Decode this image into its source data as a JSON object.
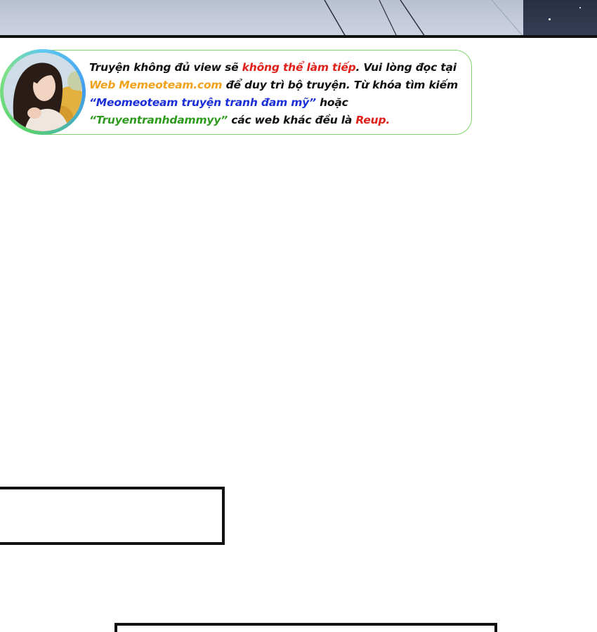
{
  "notice": {
    "line1_a": "Truyện không đủ view sẽ ",
    "line1_red": "không thể làm tiếp",
    "line1_b": ". Vui lòng đọc tại",
    "line2_orange": "Web Memeoteam.com",
    "line2_b": " để duy trì bộ truyện. Từ khóa tìm kiếm",
    "line3_blue": "“Meomeoteam truyện tranh đam mỹ”",
    "line3_b": " hoặc",
    "line4_green": "“Truyentranhdammyy”",
    "line4_b": " các web khác đều là ",
    "line4_red": "Reup."
  },
  "colors": {
    "highlight_red": "#e0201b",
    "highlight_orange": "#f0a21a",
    "highlight_blue": "#1b2fd8",
    "highlight_green": "#2f9a1f",
    "bubble_border": "#7fd36a",
    "panel_border": "#111111"
  },
  "avatar": {
    "icon": "avatar-photo"
  }
}
